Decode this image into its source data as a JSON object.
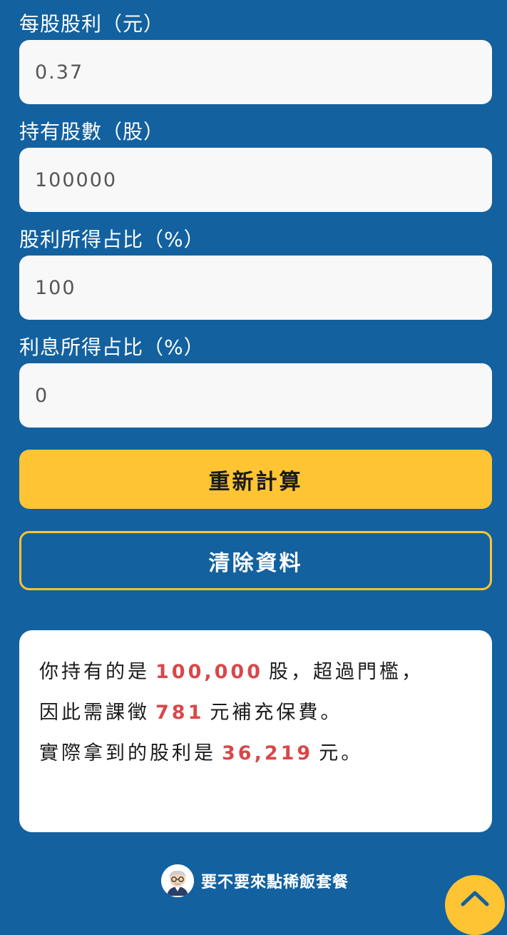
{
  "form": {
    "fields": [
      {
        "label": "每股股利（元）",
        "value": "0.37"
      },
      {
        "label": "持有股數（股）",
        "value": "100000"
      },
      {
        "label": "股利所得占比（%）",
        "value": "100"
      },
      {
        "label": "利息所得占比（%）",
        "value": "0"
      }
    ],
    "recalculate_label": "重新計算",
    "clear_label": "清除資料"
  },
  "result": {
    "line1_prefix": "你持有的是",
    "shares": "100,000",
    "line1_suffix": "股，超過門檻，",
    "line2_prefix": "因此需課徵",
    "premium": "781",
    "line2_suffix": "元補充保費。",
    "line3_prefix": "實際拿到的股利是",
    "actual_dividend": "36,219",
    "line3_suffix": "元。"
  },
  "footer": {
    "link_text": "要不要來點稀飯套餐",
    "logo_icon": "mascot-avatar-icon"
  },
  "scroll_top": {
    "icon": "chevron-up-icon"
  },
  "colors": {
    "background": "#13619f",
    "accent": "#fec434",
    "highlight": "#d9474a",
    "input_bg": "#f8f8f8"
  }
}
